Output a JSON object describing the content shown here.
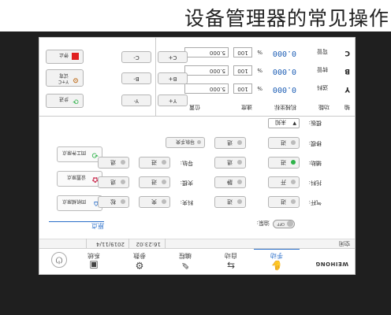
{
  "caption": "设备管理器的常见操作",
  "brand": "WEIHONG",
  "nav": [
    {
      "label": "手动",
      "icon": "hand-icon"
    },
    {
      "label": "自动",
      "icon": "auto-icon"
    },
    {
      "label": "编程",
      "icon": "program-icon"
    },
    {
      "label": "参数",
      "icon": "gear-icon"
    },
    {
      "label": "系统",
      "icon": "chip-icon"
    }
  ],
  "status": {
    "mode": "空闲",
    "date": "2019/11/4",
    "time": "16:23:02"
  },
  "side": {
    "title": "原点",
    "buttons": [
      "回机械原点",
      "设置原点",
      "回工件原点"
    ]
  },
  "io": {
    "toggle_label": "油泵:",
    "toggle_state": "OFF",
    "col1": [
      {
        "label": "气杆:",
        "text": "进"
      },
      {
        "label": "托料:",
        "text": "开"
      },
      {
        "label": "辅助:",
        "text": "进",
        "on": true
      },
      {
        "label": "移模:",
        "text": "进"
      },
      {
        "label": "模板:",
        "text": "未知",
        "select": true
      }
    ],
    "col2": [
      {
        "text": "进"
      },
      {
        "text": "静"
      },
      {
        "text": "退"
      },
      {
        "text": "退"
      }
    ],
    "col3": [
      {
        "label": "料夹:",
        "text": "夹"
      },
      {
        "label": "夹模:",
        "text": "进"
      },
      {
        "label": "导轨:",
        "text": "进"
      }
    ],
    "col4": [
      {
        "text": "松"
      },
      {
        "text": "退"
      },
      {
        "text": "退"
      }
    ],
    "manual_btn": "导轨手夹"
  },
  "table": {
    "headers": {
      "axis": "轴",
      "func": "功能",
      "mpos": "机械坐标",
      "speed": "速度",
      "pos": "位置"
    },
    "rows": [
      {
        "axis": "Y",
        "func": "送料",
        "mpos": "0.000",
        "speed": "100",
        "pct": "%",
        "pos": "5.000",
        "plus": "Y+",
        "minus": "Y-"
      },
      {
        "axis": "B",
        "func": "转管",
        "mpos": "0.000",
        "speed": "100",
        "pct": "%",
        "pos": "5.000",
        "plus": "B+",
        "minus": "B-"
      },
      {
        "axis": "C",
        "func": "弯管",
        "mpos": "0.000",
        "speed": "100",
        "pct": "%",
        "pos": "5.000",
        "plus": "C+",
        "minus": "C-"
      }
    ]
  },
  "actions": [
    "步进",
    "Y+C\n试弯",
    "停止"
  ],
  "colors": {
    "accent": "#2b6fc9",
    "on": "#2fb34a",
    "stop": "#e02020",
    "refresh": "#2fb34a"
  }
}
